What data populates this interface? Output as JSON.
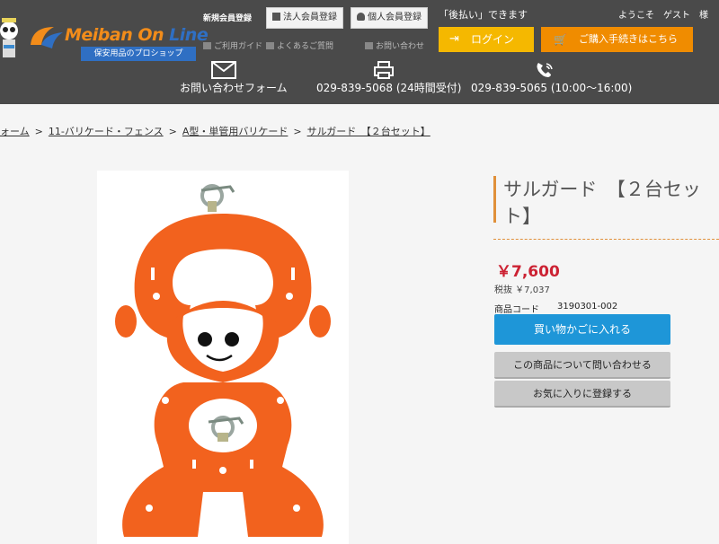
{
  "header": {
    "logo": {
      "text_a": "Meiban On",
      "text_b": " Line",
      "tagline": "保安用品のプロショップ"
    },
    "register_label": "新規会員登録",
    "corporate_register": "法人会員登録",
    "personal_register": "個人会員登録",
    "links": {
      "guide": "ご利用ガイド",
      "faq": "よくあるご質問",
      "inquiry": "お問い合わせ"
    },
    "atobarai": "「後払い」できます",
    "welcome": "ようこそ　ゲスト　様",
    "login": "ログイン",
    "checkout": "ご購入手続きはこちら",
    "contact_form": "お問い合わせフォーム",
    "fax": "029-839-5068 (24時間受付)",
    "phone": "029-839-5065 (10:00〜16:00)"
  },
  "breadcrumb": {
    "items": [
      "ォーム",
      "11-バリケード・フェンス",
      "A型・単管用バリケード",
      "サルガード　【２台セット】"
    ]
  },
  "product": {
    "title": "サルガード　【２台セット】",
    "price": "￥7,600",
    "price_tax": "税抜 ￥7,037",
    "code_label": "商品コード",
    "code_value": "3190301-002",
    "add_to_cart": "買い物かごに入れる",
    "ask": "この商品について問い合わせる",
    "favorite": "お気に入りに登録する"
  },
  "colors": {
    "header_bg": "#4a4a4a",
    "login": "#f5b800",
    "checkout": "#f08c00",
    "cart": "#1e96d8",
    "price": "#cc2233",
    "accent": "#e0903a",
    "product_orange": "#f2621e"
  }
}
